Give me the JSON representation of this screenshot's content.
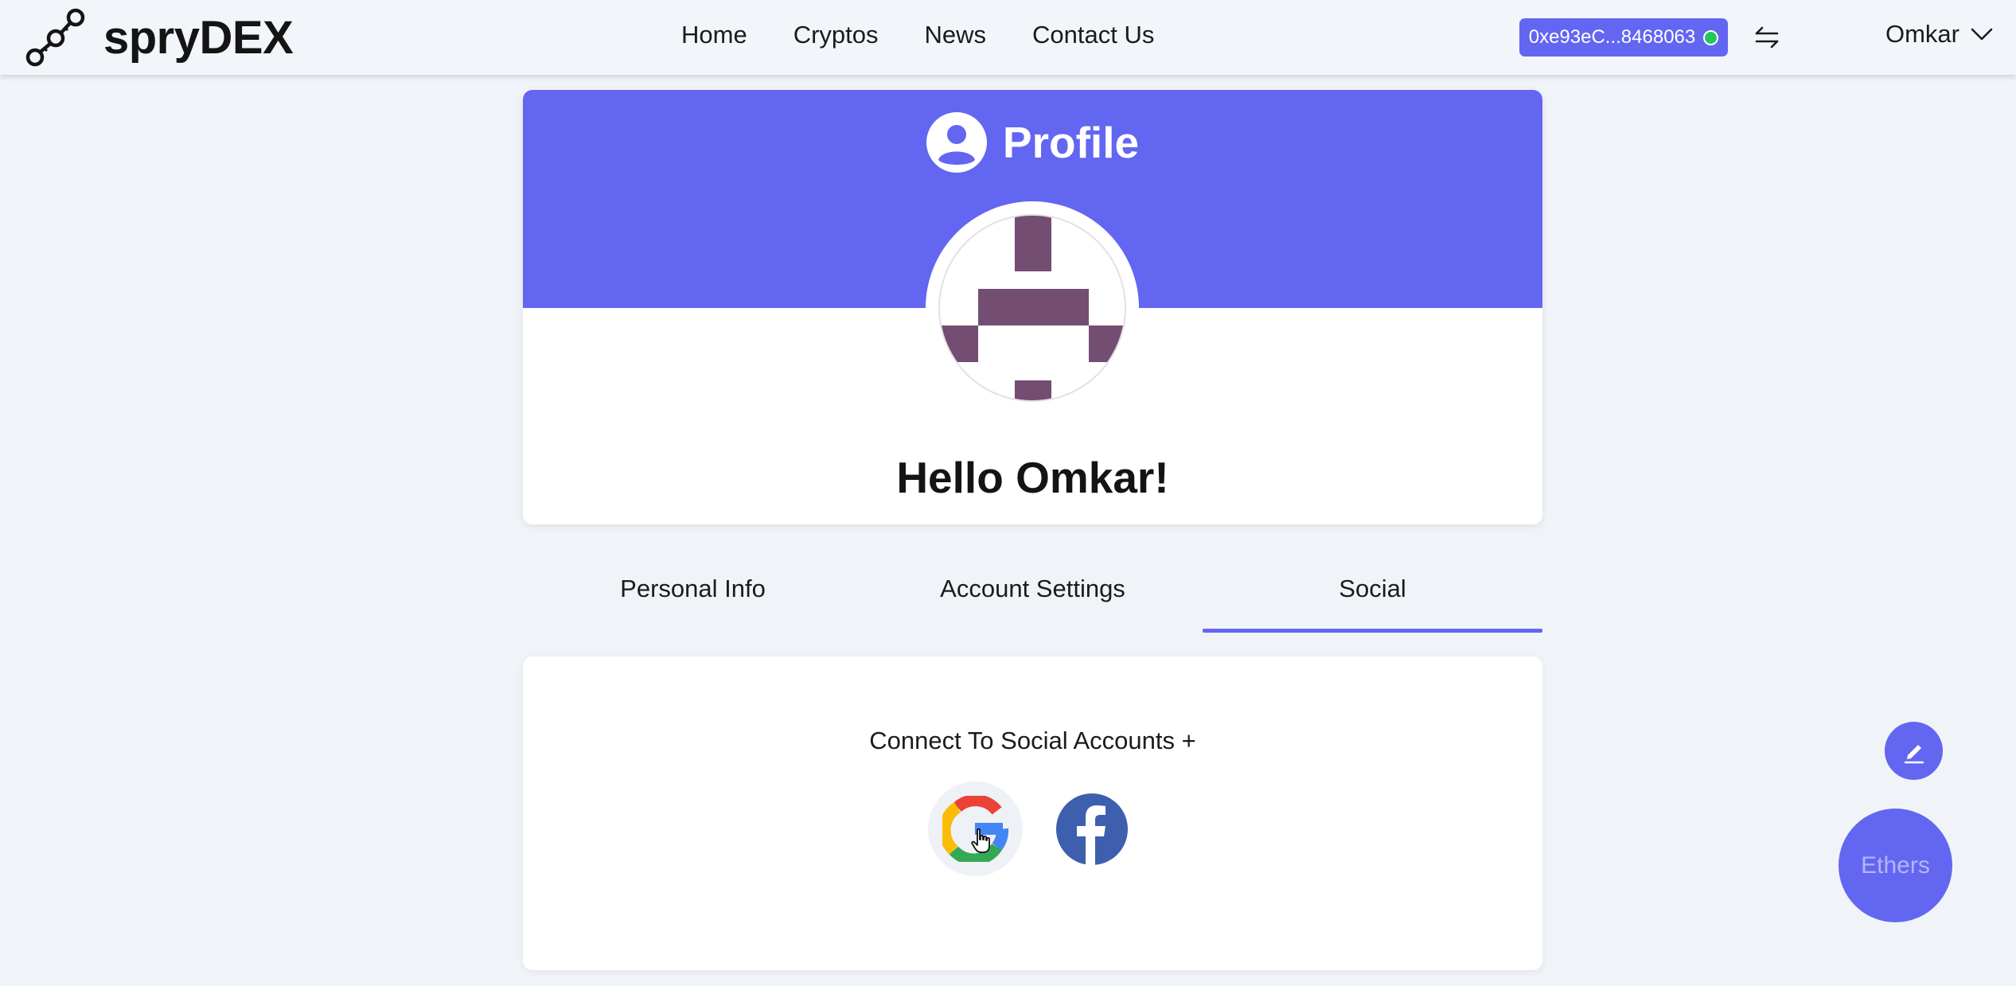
{
  "navbar": {
    "brand": "spryDEX",
    "links": [
      "Home",
      "Cryptos",
      "News",
      "Contact Us"
    ],
    "wallet_address": "0xe93eC...8468063",
    "user_name": "Omkar"
  },
  "profile": {
    "title": "Profile",
    "greeting": "Hello Omkar!"
  },
  "tabs": [
    {
      "label": "Personal Info",
      "active": false
    },
    {
      "label": "Account Settings",
      "active": false
    },
    {
      "label": "Social",
      "active": true
    }
  ],
  "social": {
    "heading": "Connect To Social Accounts +",
    "providers": [
      "google-icon",
      "facebook-icon"
    ]
  },
  "floating": {
    "ethers_label": "Ethers"
  },
  "colors": {
    "accent": "#6366f1",
    "background": "#f0f4f8",
    "avatar_block": "#744d73",
    "status_online": "#22c55e",
    "facebook": "#3d5fae"
  }
}
